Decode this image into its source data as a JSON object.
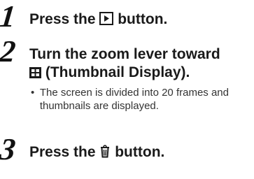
{
  "steps": [
    {
      "number": "1",
      "text_before_icon": "Press the ",
      "icon": "playback-icon",
      "text_after_icon": " button."
    },
    {
      "number": "2",
      "line1": "Turn the zoom lever toward",
      "icon": "thumbnail-display-icon",
      "line2_after_icon": " (Thumbnail Display).",
      "note": "The screen is divided into 20 frames and thumbnails are displayed."
    },
    {
      "number": "3",
      "text_before_icon": "Press the ",
      "icon": "trash-icon",
      "text_after_icon": " button."
    }
  ]
}
